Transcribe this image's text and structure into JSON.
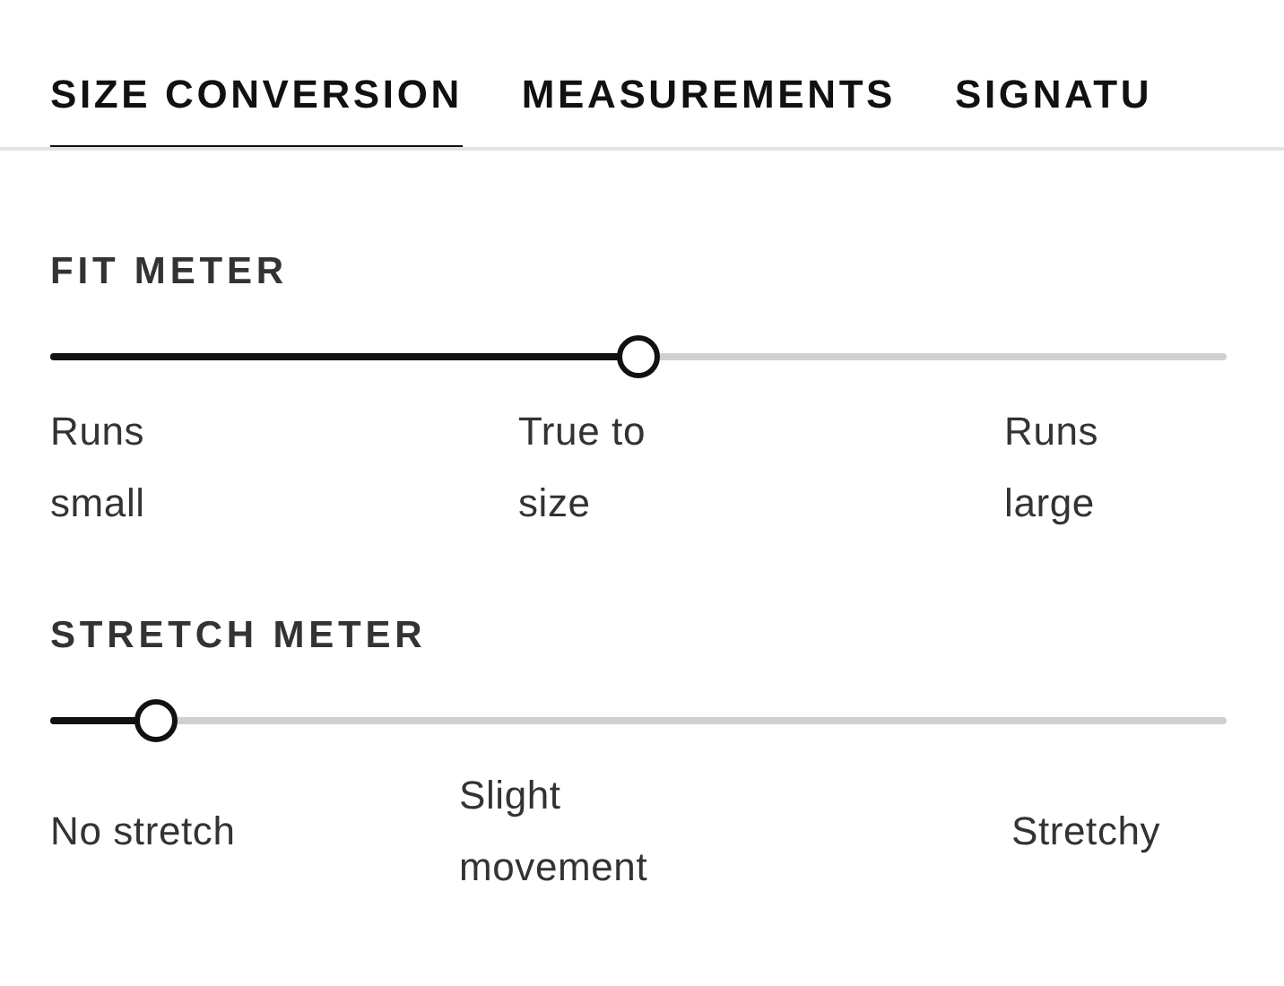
{
  "tabs": [
    {
      "label": "SIZE CONVERSION",
      "selected": true
    },
    {
      "label": "MEASUREMENTS",
      "selected": false
    },
    {
      "label": "SIGNATU",
      "selected": false
    }
  ],
  "meters": [
    {
      "title": "FIT METER",
      "level": 0.5,
      "labels": [
        "Runs small",
        "True to size",
        "Runs large"
      ]
    },
    {
      "title": "STRETCH METER",
      "level": 0.09,
      "labels": [
        "No stretch",
        "Slight movement",
        "Stretchy"
      ]
    }
  ]
}
